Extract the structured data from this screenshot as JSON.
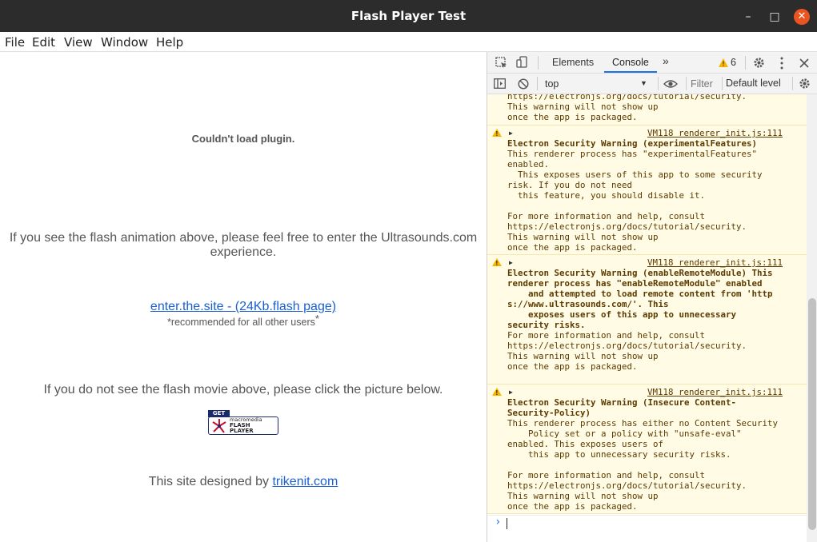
{
  "window": {
    "title": "Flash Player Test",
    "minimize": "–",
    "maximize": "□",
    "close": "✕"
  },
  "menu": [
    "File",
    "Edit",
    "View",
    "Window",
    "Help"
  ],
  "page": {
    "plugin_error": "Couldn't load plugin.",
    "intro_line1": "If you see the flash animation above, please feel free to enter the Ultrasounds.com",
    "intro_line2": "experience.",
    "enter_link": "enter.the.site - (24Kb.flash page)",
    "recommended": "*recommended for all other users",
    "recommended_star": "*",
    "no_flash": "If you do not see the flash movie above, please click the picture below.",
    "badge_get": "GET",
    "badge_line1": "macromedia",
    "badge_line2": "FLASH",
    "badge_line3": "PLAYER",
    "designed_by": "This site designed by ",
    "designer_link": "trikenit.com"
  },
  "devtools": {
    "tabs": {
      "elements": "Elements",
      "console": "Console",
      "more": "»"
    },
    "warning_count": "6",
    "context": "top",
    "filter_placeholder": "Filter",
    "level": "Default level",
    "messages": [
      {
        "lines": "https://electronjs.org/docs/tutorial/security.\nThis warning will not show up\nonce the app is packaged."
      },
      {
        "source": "VM118 renderer_init.js:111",
        "title": "Electron Security Warning (experimentalFeatures)",
        "lines": "This renderer process has \"experimentalFeatures\"\nenabled.\n  This exposes users of this app to some security\nrisk. If you do not need\n  this feature, you should disable it.\n\nFor more information and help, consult\nhttps://electronjs.org/docs/tutorial/security.\nThis warning will not show up\nonce the app is packaged."
      },
      {
        "source": "VM118 renderer_init.js:111",
        "title": "Electron Security Warning (enableRemoteModule) This\nrenderer process has \"enableRemoteModule\" enabled\n    and attempted to load remote content from 'http\ns://www.ultrasounds.com/'. This\n    exposes users of this app to unnecessary\nsecurity risks.",
        "lines": "\nFor more information and help, consult\nhttps://electronjs.org/docs/tutorial/security.\nThis warning will not show up\nonce the app is packaged."
      },
      {
        "source": "VM118 renderer_init.js:111",
        "title": "Electron Security Warning (Insecure Content-\nSecurity-Policy)",
        "lines": "This renderer process has either no Content Security\n    Policy set or a policy with \"unsafe-eval\"\nenabled. This exposes users of\n    this app to unnecessary security risks.\n\nFor more information and help, consult\nhttps://electronjs.org/docs/tutorial/security.\nThis warning will not show up\nonce the app is packaged."
      }
    ],
    "prompt": "›"
  },
  "colors": {
    "titlebar": "#2c2c2c",
    "close_button": "#e95420",
    "link": "#1a5fd0",
    "warning_bg": "#fffbe5",
    "warning_icon": "#f4b400",
    "console_tab_underline": "#1a73e8"
  }
}
